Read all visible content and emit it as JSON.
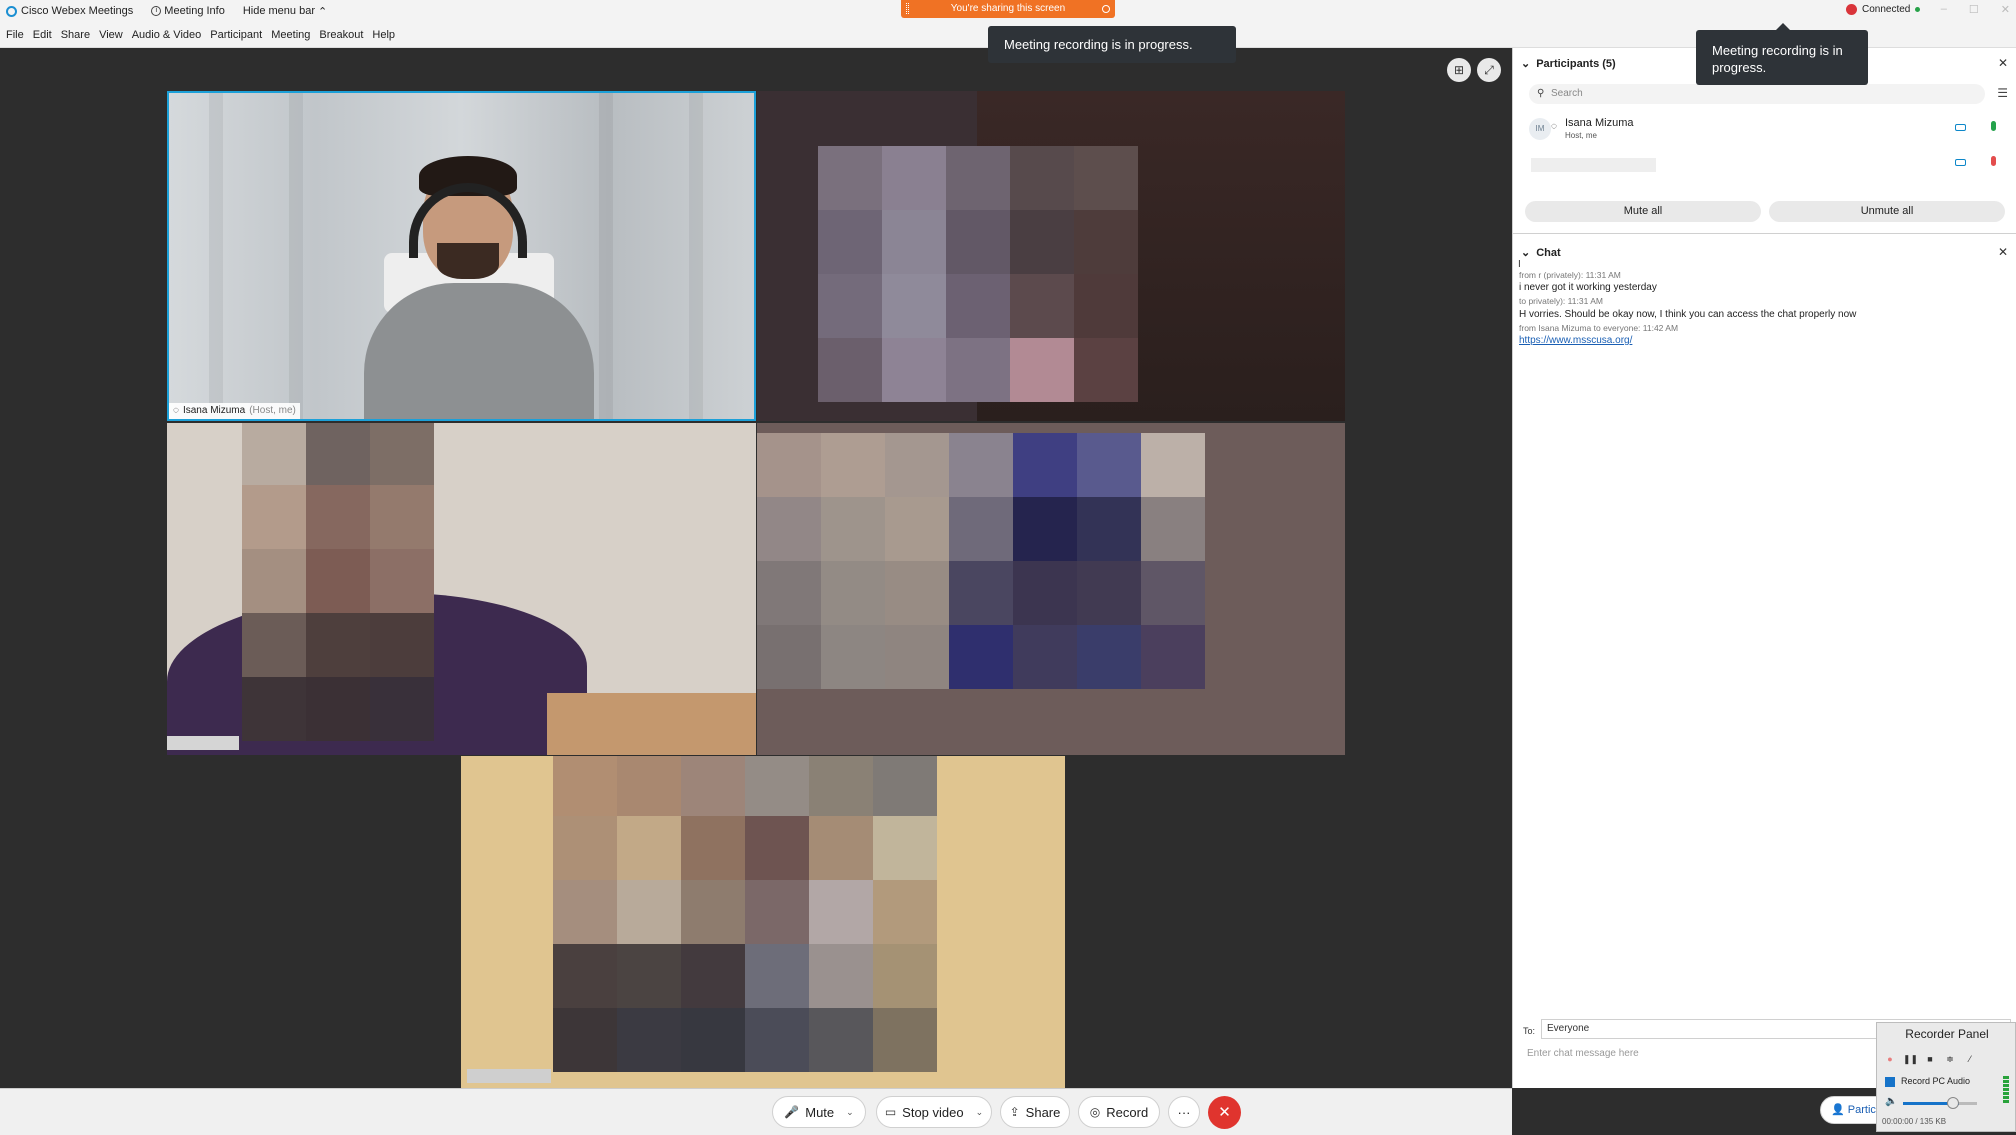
{
  "titlebar": {
    "app_name": "Cisco Webex Meetings",
    "meeting_info": "Meeting Info",
    "hide_menu": "Hide menu bar",
    "share_banner": "You're sharing this screen",
    "connected": "Connected"
  },
  "menu": [
    "File",
    "Edit",
    "Share",
    "View",
    "Audio & Video",
    "Participant",
    "Meeting",
    "Breakout",
    "Help"
  ],
  "tooltips": {
    "recording_main": "Meeting recording is in progress.",
    "recording_panel": "Meeting recording is in progress."
  },
  "video": {
    "host_name": "Isana Mizuma",
    "host_suffix": "(Host, me)"
  },
  "controls": {
    "mute": "Mute",
    "stop_video": "Stop video",
    "share": "Share",
    "record": "Record",
    "more": "···"
  },
  "participants": {
    "title": "Participants (5)",
    "search_placeholder": "Search",
    "host_initials": "IM",
    "host_name": "Isana Mizuma",
    "host_role": "Host, me",
    "mute_all": "Mute all",
    "unmute_all": "Unmute all"
  },
  "chat": {
    "title": "Chat",
    "messages": [
      {
        "meta": "from          r (privately):   11:31 AM",
        "text": "i never got it working yesterday"
      },
      {
        "meta": "to             privately):   11:31 AM",
        "text": "H            vorries. Should be okay now, I think you can access the chat properly now"
      },
      {
        "meta": "from Isana Mizuma to everyone:   11:42 AM",
        "link": "https://www.msscusa.org/"
      }
    ],
    "to_label": "To:",
    "to_value": "Everyone",
    "input_placeholder": "Enter chat message here"
  },
  "recorder": {
    "title": "Recorder Panel",
    "record_pc_audio": "Record PC Audio",
    "status": "00:00:00 / 135 KB"
  },
  "partic_button": "Partic",
  "colors": {
    "accent": "#1ca0d8",
    "share_banner": "#f07224",
    "end_call": "#e0342e",
    "link": "#1a5fb4"
  }
}
